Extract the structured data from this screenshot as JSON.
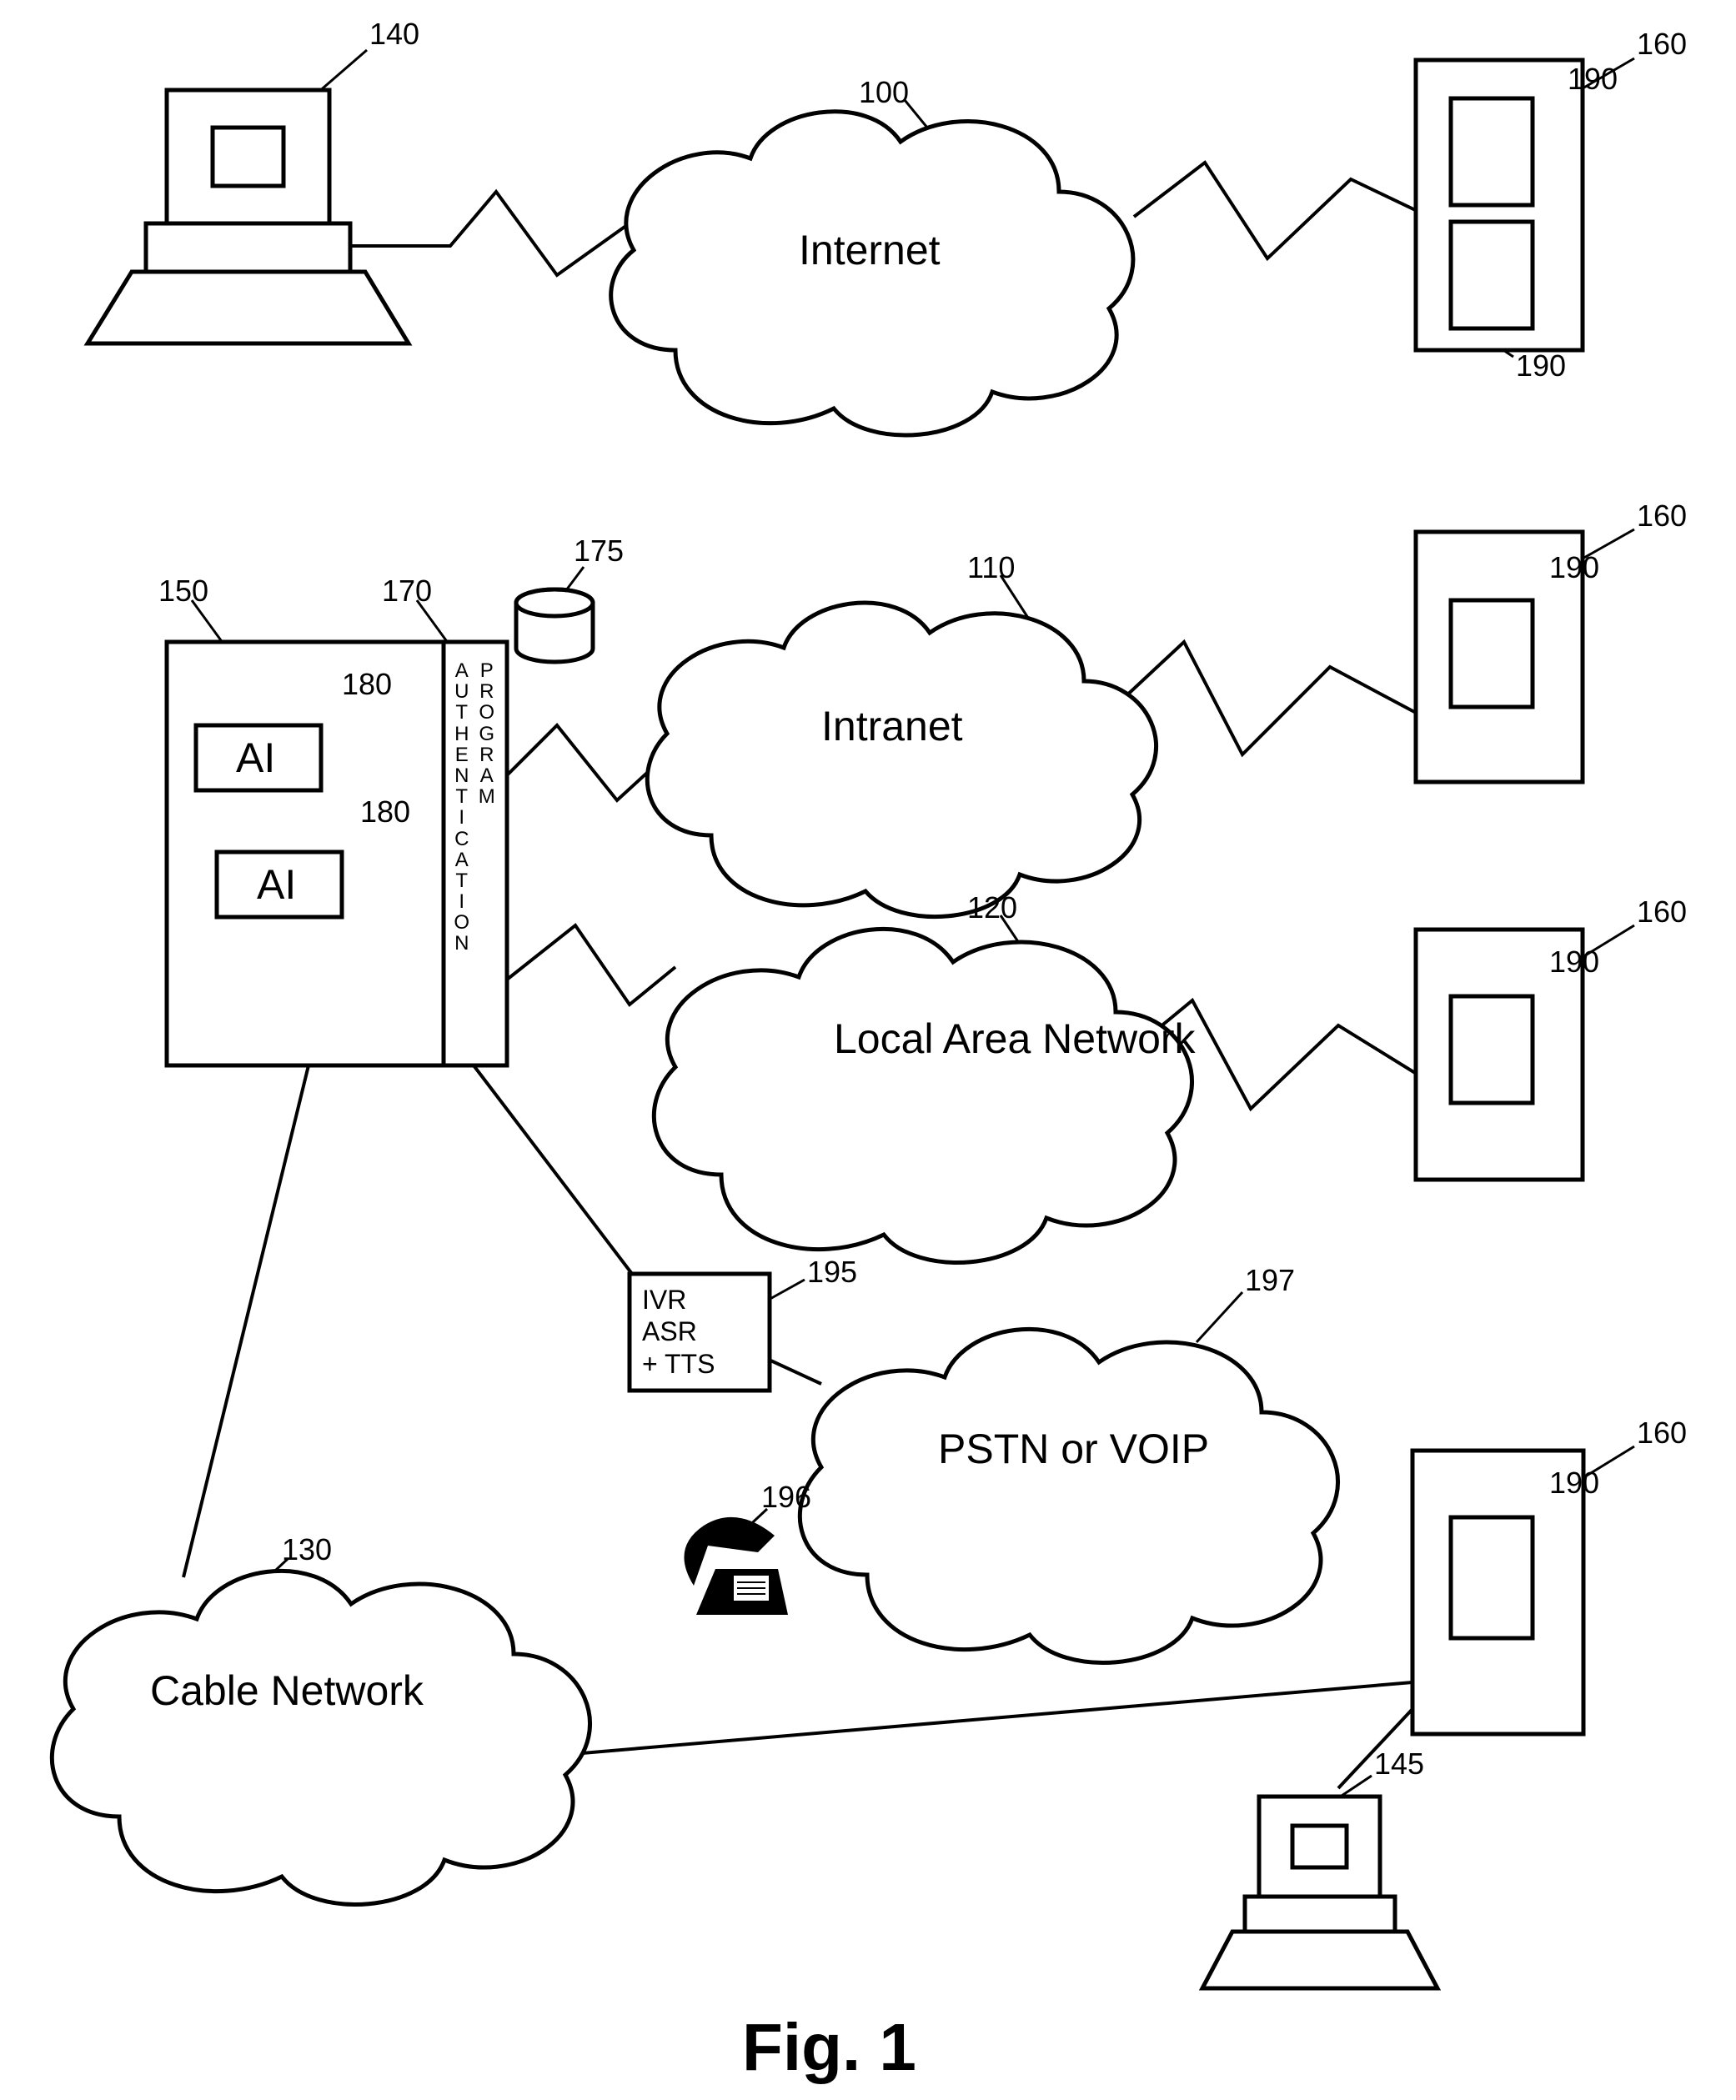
{
  "figure_caption": "Fig. 1",
  "clouds": {
    "internet": {
      "label": "Internet",
      "ref": "100"
    },
    "intranet": {
      "label": "Intranet",
      "ref": "110"
    },
    "lan": {
      "label": "Local\nArea\nNetwork",
      "ref": "120"
    },
    "cable": {
      "label": "Cable\nNetwork",
      "ref": "130"
    },
    "pstn": {
      "label": "PSTN\nor VOIP",
      "ref": "197"
    }
  },
  "computers": {
    "left": {
      "ref": "140"
    },
    "right": {
      "ref": "145"
    }
  },
  "server": {
    "ref": "150",
    "auth_col_ref": "170",
    "auth_col_left": "AUTHENTICATION",
    "auth_col_right": "PROGRAM",
    "cylinder_ref": "175",
    "ai_boxes": [
      {
        "text": "AI",
        "ref": "180"
      },
      {
        "text": "AI",
        "ref": "180"
      }
    ]
  },
  "ivr_box": {
    "line1": "IVR",
    "line2": "   ASR",
    "line3": "+ TTS",
    "ref": "195"
  },
  "phone": {
    "ref": "196"
  },
  "remote_servers": [
    {
      "ref": "160",
      "modules": [
        {
          "ref": "190"
        },
        {
          "ref": "190"
        }
      ]
    },
    {
      "ref": "160",
      "modules": [
        {
          "ref": "190"
        }
      ]
    },
    {
      "ref": "160",
      "modules": [
        {
          "ref": "190"
        }
      ]
    },
    {
      "ref": "160",
      "modules": [
        {
          "ref": "190"
        }
      ]
    }
  ]
}
